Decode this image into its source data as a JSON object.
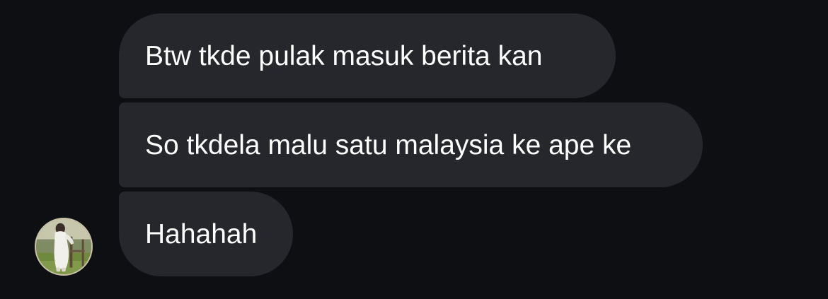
{
  "messages": [
    {
      "text": "Btw tkde pulak masuk berita kan"
    },
    {
      "text": "So tkdela malu satu malaysia ke ape ke"
    },
    {
      "text": "Hahahah"
    }
  ],
  "sender": {
    "avatar_icon": "profile-photo-person-in-white-outfit"
  },
  "colors": {
    "background": "#0d0f13",
    "bubble": "#25272c",
    "text": "#ffffff"
  }
}
